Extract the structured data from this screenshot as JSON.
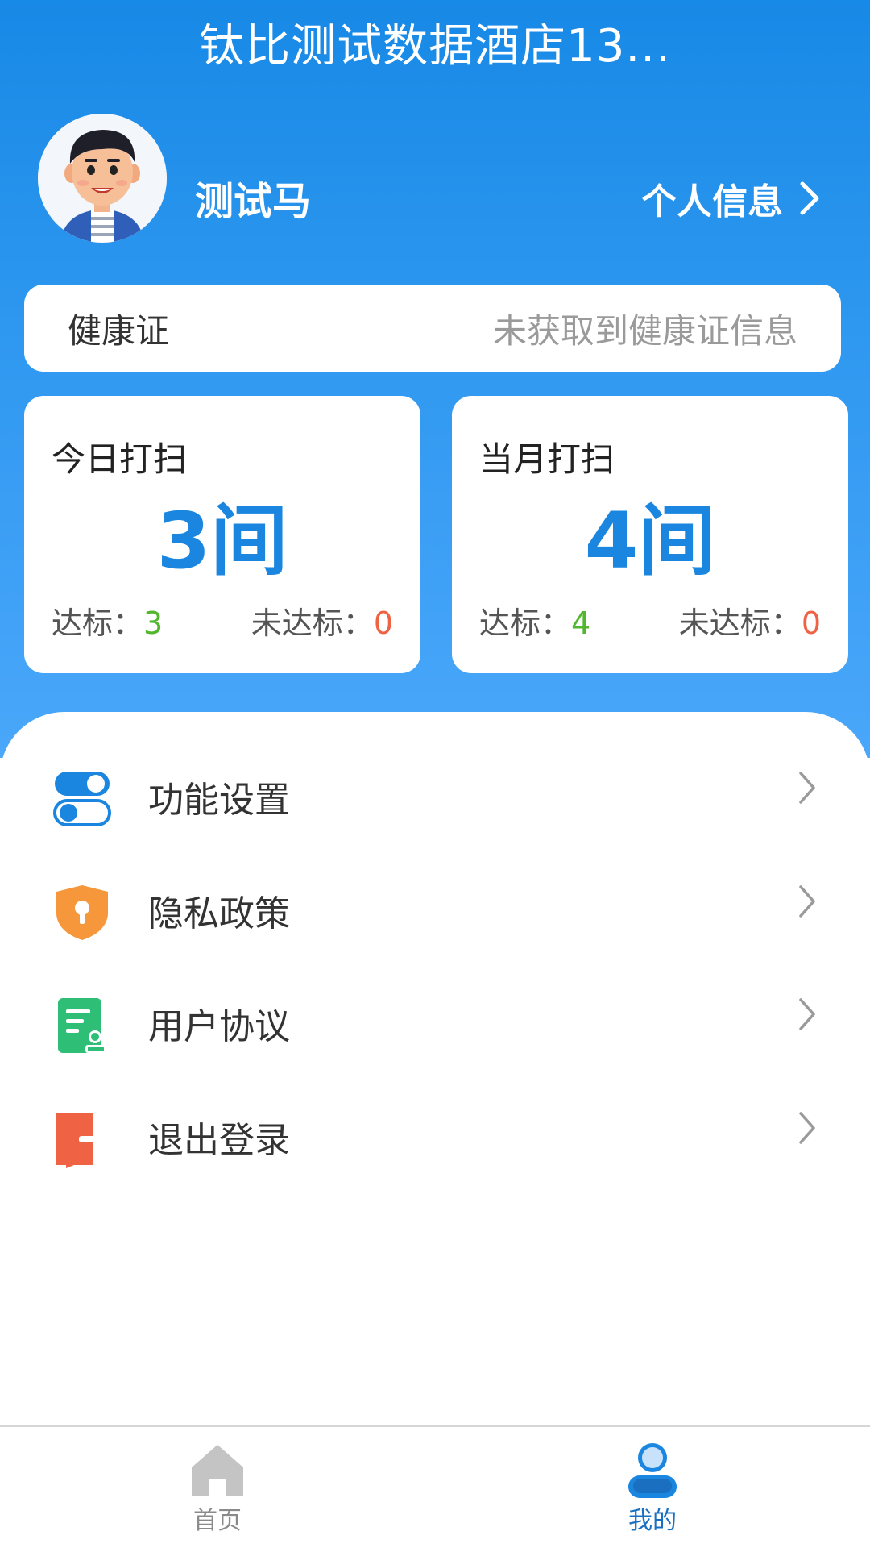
{
  "header": {
    "title": "钛比测试数据酒店13..."
  },
  "profile": {
    "username": "测试马",
    "link_label": "个人信息"
  },
  "health_cert": {
    "label": "健康证",
    "value": "未获取到健康证信息"
  },
  "stats": [
    {
      "title": "今日打扫",
      "count": "3间",
      "ok_label": "达标：",
      "ok_value": "3",
      "nok_label": "未达标：",
      "nok_value": "0"
    },
    {
      "title": "当月打扫",
      "count": "4间",
      "ok_label": "达标：",
      "ok_value": "4",
      "nok_label": "未达标：",
      "nok_value": "0"
    }
  ],
  "menu": [
    {
      "label": "功能设置",
      "icon": "toggle-settings-icon"
    },
    {
      "label": "隐私政策",
      "icon": "privacy-shield-icon"
    },
    {
      "label": "用户协议",
      "icon": "user-agreement-icon"
    },
    {
      "label": "退出登录",
      "icon": "logout-icon"
    }
  ],
  "tabs": [
    {
      "label": "首页",
      "icon": "home-icon",
      "active": false
    },
    {
      "label": "我的",
      "icon": "user-icon",
      "active": true
    }
  ],
  "colors": {
    "primary": "#1a86e0",
    "ok": "#52b72e",
    "not_ok": "#ef6244",
    "inactive_tab": "#bdbdbd"
  }
}
